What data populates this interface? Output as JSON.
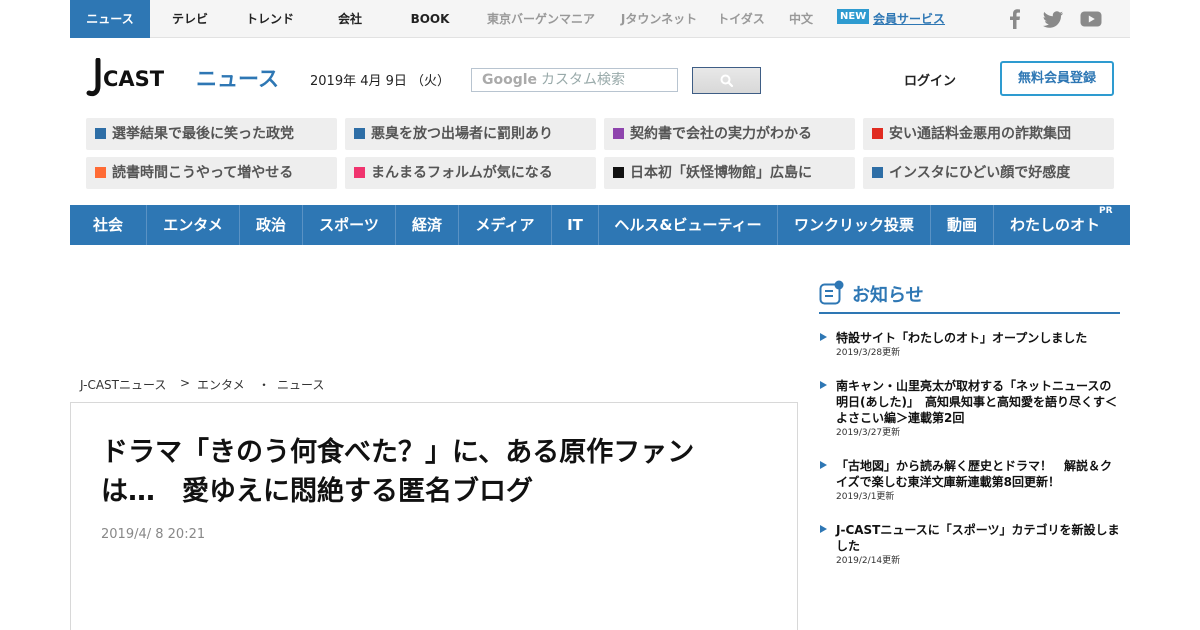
{
  "topbar": {
    "tabs": [
      "ニュース",
      "テレビ",
      "トレンド",
      "会社",
      "BOOK",
      "東京バーゲンマニア",
      "Jタウンネット",
      "トイダス",
      "中文"
    ],
    "new_badge": "NEW",
    "member_service": "会員サービス",
    "social_icons": [
      "facebook-icon",
      "twitter-icon",
      "youtube-icon"
    ]
  },
  "header": {
    "logo_text": "J-CAST ニュース",
    "date": "2019年 4月 9日 （火）",
    "search_placeholder_brand": "Google",
    "search_placeholder": "カスタム検索",
    "login": "ログイン",
    "register": "無料会員登録"
  },
  "topics": [
    {
      "label": "選挙結果で最後に笑った政党",
      "color": "#2e6ea6"
    },
    {
      "label": "悪臭を放つ出場者に罰則あり",
      "color": "#2e6ea6"
    },
    {
      "label": "契約書で会社の実力がわかる",
      "color": "#8e44ad"
    },
    {
      "label": "安い通話料金悪用の詐欺集団",
      "color": "#e02b20"
    },
    {
      "label": "読書時間こうやって増やせる",
      "color": "#ff6b35"
    },
    {
      "label": "まんまるフォルムが気になる",
      "color": "#f0346e"
    },
    {
      "label": "日本初「妖怪博物館」広島に",
      "color": "#111111"
    },
    {
      "label": "インスタにひどい顔で好感度",
      "color": "#2e6ea6"
    }
  ],
  "categories": [
    "社会",
    "エンタメ",
    "政治",
    "スポーツ",
    "経済",
    "メディア",
    "IT",
    "ヘルス&ビューティー",
    "ワンクリック投票",
    "動画",
    "わたしのオト"
  ],
  "categories_pr": "PR",
  "breadcrumb": [
    "J-CASTニュース",
    ">",
    "エンタメ",
    "・",
    "ニュース"
  ],
  "article": {
    "title_line1": "ドラマ「きのう何食べた？」に、ある原作ファン",
    "title_line2": "は…　愛ゆえに悶絶する匿名ブログ",
    "date": "2019/4/ 8 20:21"
  },
  "notices": {
    "heading": "お知らせ",
    "items": [
      {
        "title": "特設サイト「わたしのオト」オープンしました",
        "date": "2019/3/28更新"
      },
      {
        "title": "南キャン・山里亮太が取材する「ネットニュースの明日(あした)」　高知県知事と高知愛を語り尽くす＜よさこい編＞連載第2回",
        "date": "2019/3/27更新"
      },
      {
        "title": "「古地図」から読み解く歴史とドラマ！　解説＆クイズで楽しむ東洋文庫新連載第8回更新！",
        "date": "2019/3/1更新"
      },
      {
        "title": "J-CASTニュースに「スポーツ」カテゴリを新設しました",
        "date": "2019/2/14更新"
      }
    ]
  },
  "colors": {
    "brand_blue": "#2e77b4",
    "register_border": "#2e9bd0",
    "new_badge": "#2e9bd0"
  }
}
